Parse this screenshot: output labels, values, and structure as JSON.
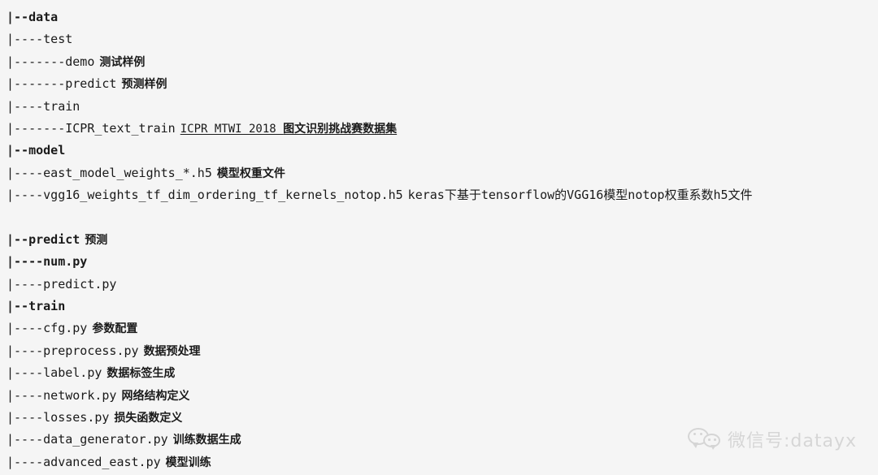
{
  "document": {
    "kind": "project-directory-tree",
    "background_color": "#f5f5f5",
    "text_color": "#1a1a1a",
    "lines": [
      {
        "path": "|--data",
        "bold": true,
        "note": "",
        "note_kind": ""
      },
      {
        "path": "|----test",
        "bold": false,
        "note": "",
        "note_kind": ""
      },
      {
        "path": "|-------demo",
        "bold": false,
        "note": "测试样例",
        "note_kind": "cjk"
      },
      {
        "path": "|-------predict",
        "bold": false,
        "note": "预测样例",
        "note_kind": "cjk"
      },
      {
        "path": "|----train",
        "bold": false,
        "note": "",
        "note_kind": ""
      },
      {
        "path": "|-------ICPR_text_train",
        "bold": false,
        "note": "ICPR MTWI 2018 图文识别挑战赛数据集",
        "note_kind": "link"
      },
      {
        "path": "|--model",
        "bold": true,
        "note": "",
        "note_kind": ""
      },
      {
        "path": "|----east_model_weights_*.h5",
        "bold": false,
        "note": "模型权重文件",
        "note_kind": "cjk"
      },
      {
        "path": "|----vgg16_weights_tf_dim_ordering_tf_kernels_notop.h5",
        "bold": false,
        "note": "keras下基于tensorflow的VGG16模型notop权重系数h5文件",
        "note_kind": "mono"
      },
      {
        "path": "",
        "bold": false,
        "note": "",
        "note_kind": "blank"
      },
      {
        "path": "|--predict",
        "bold": true,
        "note": "预测",
        "note_kind": "cjk"
      },
      {
        "path": "|----num.py",
        "bold": true,
        "note": "",
        "note_kind": ""
      },
      {
        "path": "|----predict.py",
        "bold": false,
        "note": "",
        "note_kind": ""
      },
      {
        "path": "|--train",
        "bold": true,
        "note": "",
        "note_kind": ""
      },
      {
        "path": "|----cfg.py",
        "bold": false,
        "note": "参数配置",
        "note_kind": "cjk"
      },
      {
        "path": "|----preprocess.py",
        "bold": false,
        "note": "数据预处理",
        "note_kind": "cjk"
      },
      {
        "path": "|----label.py",
        "bold": false,
        "note": "数据标签生成",
        "note_kind": "cjk"
      },
      {
        "path": "|----network.py",
        "bold": false,
        "note": "网络结构定义",
        "note_kind": "cjk"
      },
      {
        "path": "|----losses.py",
        "bold": false,
        "note": "损失函数定义",
        "note_kind": "cjk"
      },
      {
        "path": "|----data_generator.py",
        "bold": false,
        "note": "训练数据生成",
        "note_kind": "cjk"
      },
      {
        "path": "|----advanced_east.py",
        "bold": false,
        "note": "模型训练",
        "note_kind": "cjk"
      }
    ]
  },
  "watermark": {
    "icon": "wechat-icon",
    "text": "微信号:datayx",
    "color": "#9d9d9d"
  }
}
